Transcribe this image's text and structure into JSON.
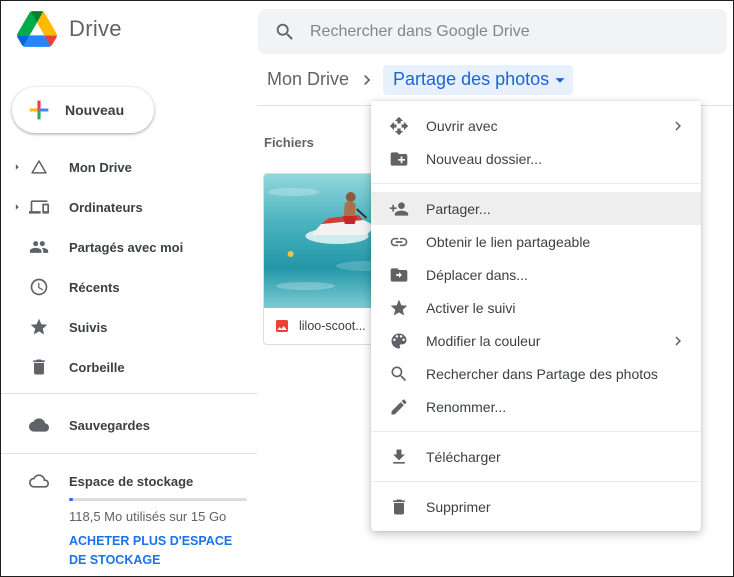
{
  "header": {
    "app_name": "Drive",
    "search_placeholder": "Rechercher dans Google Drive"
  },
  "breadcrumb": {
    "root": "Mon Drive",
    "current_folder": "Partage des photos"
  },
  "sidebar": {
    "new_button_label": "Nouveau",
    "items": [
      {
        "label": "Mon Drive",
        "icon": "drive-icon",
        "expandable": true
      },
      {
        "label": "Ordinateurs",
        "icon": "devices-icon",
        "expandable": true
      },
      {
        "label": "Partagés avec moi",
        "icon": "people-icon"
      },
      {
        "label": "Récents",
        "icon": "clock-icon"
      },
      {
        "label": "Suivis",
        "icon": "star-icon"
      },
      {
        "label": "Corbeille",
        "icon": "trash-icon"
      }
    ],
    "backups_label": "Sauvegardes",
    "backups_icon": "cloud-icon",
    "storage": {
      "label": "Espace de stockage",
      "icon": "cloud-outline-icon",
      "usage_text": "118,5 Mo utilisés sur 15 Go",
      "buy_link": "ACHETER PLUS D'ESPACE DE STOCKAGE"
    }
  },
  "main": {
    "section_label": "Fichiers",
    "files": [
      {
        "name": "liloo-scoot...",
        "type_icon": "image-file-icon"
      }
    ]
  },
  "context_menu": {
    "items": [
      {
        "label": "Ouvrir avec",
        "icon": "open-with-icon",
        "has_submenu": true
      },
      {
        "label": "Nouveau dossier...",
        "icon": "new-folder-icon"
      },
      {
        "label": "Partager...",
        "icon": "add-person-icon",
        "highlighted": true
      },
      {
        "label": "Obtenir le lien partageable",
        "icon": "link-icon"
      },
      {
        "label": "Déplacer dans...",
        "icon": "move-to-folder-icon"
      },
      {
        "label": "Activer le suivi",
        "icon": "star-icon"
      },
      {
        "label": "Modifier la couleur",
        "icon": "palette-icon",
        "has_submenu": true
      },
      {
        "label": "Rechercher dans Partage des photos",
        "icon": "search-icon"
      },
      {
        "label": "Renommer...",
        "icon": "rename-icon"
      },
      {
        "label": "Télécharger",
        "icon": "download-icon"
      },
      {
        "label": "Supprimer",
        "icon": "trash-icon"
      }
    ]
  },
  "colors": {
    "accent_blue": "#1a73e8",
    "chip_background": "#e8f0fe",
    "chip_text": "#1967d2",
    "text_primary": "#3c4043",
    "text_secondary": "#5f6368",
    "menu_highlight": "#eeeeee",
    "search_background": "#f1f3f4",
    "image_file_icon_color": "#ea4335"
  }
}
